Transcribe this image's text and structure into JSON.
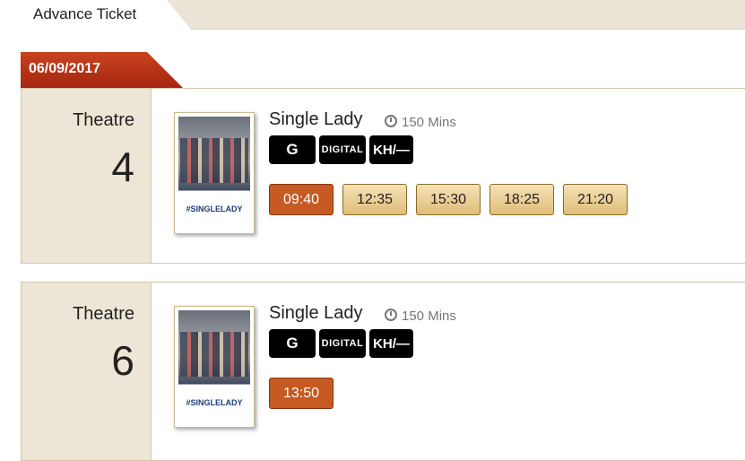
{
  "tabs": {
    "advance_ticket": "Advance Ticket"
  },
  "date": "06/09/2017",
  "theatres": [
    {
      "label": "Theatre",
      "number": "4",
      "movie": {
        "title": "Single Lady",
        "duration": "150 Mins",
        "badges": [
          "G",
          "DIGITAL",
          "KH/—"
        ],
        "poster_text": "#SINGLELADY",
        "showtimes": [
          "09:40",
          "12:35",
          "15:30",
          "18:25",
          "21:20"
        ],
        "selected_showtime": "09:40"
      }
    },
    {
      "label": "Theatre",
      "number": "6",
      "movie": {
        "title": "Single Lady",
        "duration": "150 Mins",
        "badges": [
          "G",
          "DIGITAL",
          "KH/—"
        ],
        "poster_text": "#SINGLELADY",
        "showtimes": [
          "13:50"
        ],
        "selected_showtime": "13:50"
      }
    }
  ],
  "colors": {
    "accent": "#c65a23",
    "date_tab": "#b8341a",
    "side_bg": "#ede6d6",
    "border": "#d2c8ac"
  }
}
